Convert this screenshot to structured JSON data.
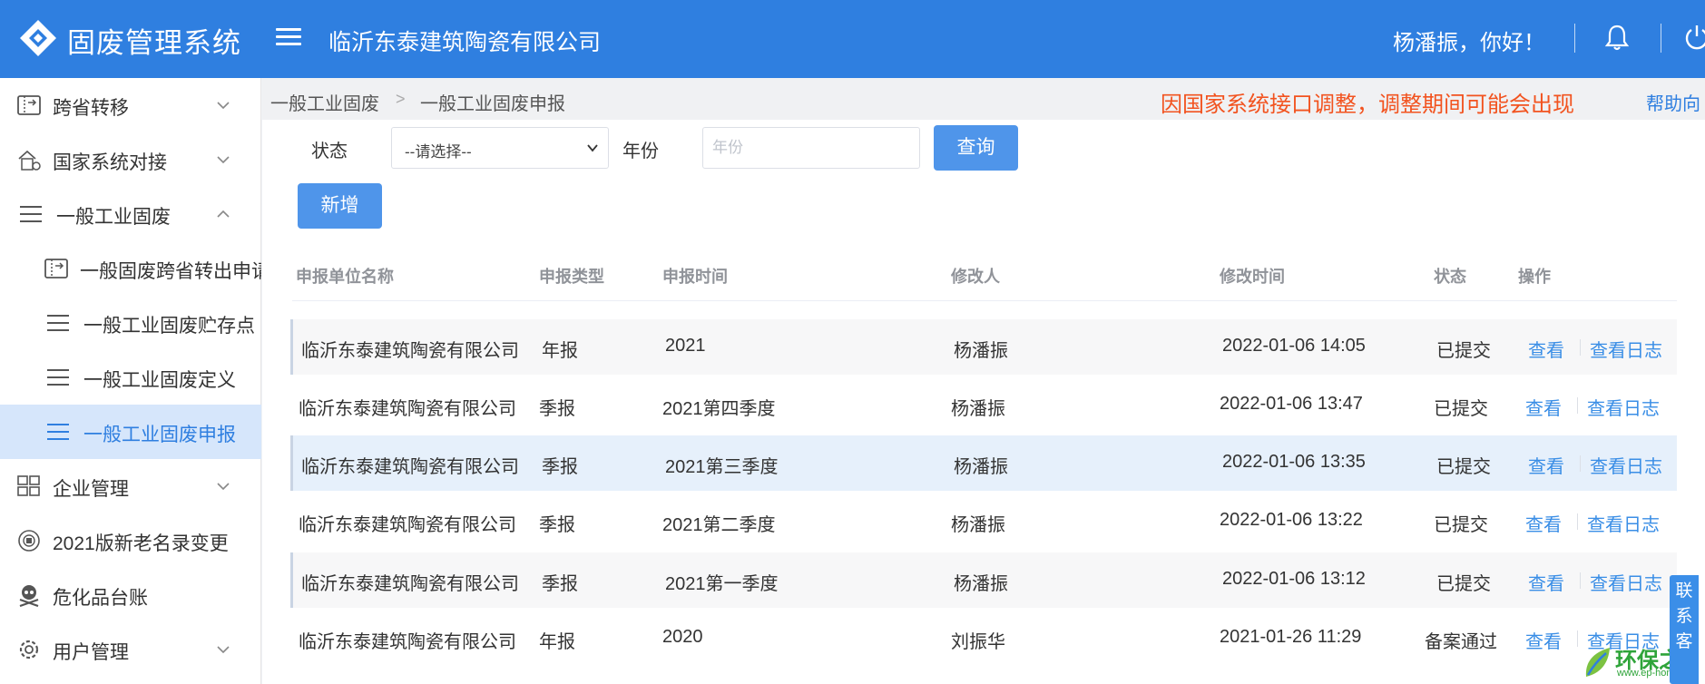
{
  "header": {
    "app_title": "固废管理系统",
    "company_name": "临沂东泰建筑陶瓷有限公司",
    "greeting": "杨潘振，你好！"
  },
  "sidebar": {
    "items": [
      {
        "label": "跨省转移",
        "icon": "transfer-icon",
        "expanded": false
      },
      {
        "label": "国家系统对接",
        "icon": "building-icon",
        "expanded": false
      },
      {
        "label": "一般工业固废",
        "icon": "list-icon",
        "expanded": true
      },
      {
        "label": "一般固废跨省转出申请",
        "icon": "transfer-icon"
      },
      {
        "label": "一般工业固废贮存点",
        "icon": "list-icon"
      },
      {
        "label": "一般工业固废定义",
        "icon": "list-icon"
      },
      {
        "label": "一般工业固废申报",
        "icon": "list-icon",
        "active": true
      },
      {
        "label": "企业管理",
        "icon": "grid-icon",
        "expanded": false
      },
      {
        "label": "2021版新老名录变更",
        "icon": "emblem-icon"
      },
      {
        "label": "危化品台账",
        "icon": "skull-icon"
      },
      {
        "label": "用户管理",
        "icon": "gear-icon",
        "expanded": false
      }
    ]
  },
  "breadcrumb": {
    "items": [
      "一般工业固废",
      "一般工业固废申报"
    ],
    "separator": ">"
  },
  "notice": "因国家系统接口调整，调整期间可能会出现",
  "help_link": "帮助向",
  "filter": {
    "status_label": "状态",
    "status_value": "--请选择--",
    "year_label": "年份",
    "year_placeholder": "年份",
    "query_button": "查询",
    "add_button": "新增"
  },
  "table": {
    "columns": [
      "申报单位名称",
      "申报类型",
      "申报时间",
      "修改人",
      "修改时间",
      "状态",
      "操作"
    ],
    "rows": [
      {
        "company": "临沂东泰建筑陶瓷有限公司",
        "type": "年报",
        "period": "2021",
        "modifier": "杨潘振",
        "modified": "2022-01-06 14:05",
        "status": "已提交",
        "view": "查看",
        "log": "查看日志"
      },
      {
        "company": "临沂东泰建筑陶瓷有限公司",
        "type": "季报",
        "period": "2021第四季度",
        "modifier": "杨潘振",
        "modified": "2022-01-06 13:47",
        "status": "已提交",
        "view": "查看",
        "log": "查看日志"
      },
      {
        "company": "临沂东泰建筑陶瓷有限公司",
        "type": "季报",
        "period": "2021第三季度",
        "modifier": "杨潘振",
        "modified": "2022-01-06 13:35",
        "status": "已提交",
        "view": "查看",
        "log": "查看日志"
      },
      {
        "company": "临沂东泰建筑陶瓷有限公司",
        "type": "季报",
        "period": "2021第二季度",
        "modifier": "杨潘振",
        "modified": "2022-01-06 13:22",
        "status": "已提交",
        "view": "查看",
        "log": "查看日志"
      },
      {
        "company": "临沂东泰建筑陶瓷有限公司",
        "type": "季报",
        "period": "2021第一季度",
        "modifier": "杨潘振",
        "modified": "2022-01-06 13:12",
        "status": "已提交",
        "view": "查看",
        "log": "查看日志"
      },
      {
        "company": "临沂东泰建筑陶瓷有限公司",
        "type": "年报",
        "period": "2020",
        "modifier": "刘振华",
        "modified": "2021-01-26 11:29",
        "status": "备案通过",
        "view": "查看",
        "log": "查看日志"
      }
    ]
  },
  "contact_float": "联系客",
  "watermark": {
    "text": "环保之",
    "sub": "www.ep-home.c"
  },
  "colors": {
    "header_bg": "#2f7fe0",
    "accent": "#2f7fe0",
    "notice": "#f2531f",
    "button": "#4f95ea",
    "active_nav_bg": "#d6e6fb"
  }
}
